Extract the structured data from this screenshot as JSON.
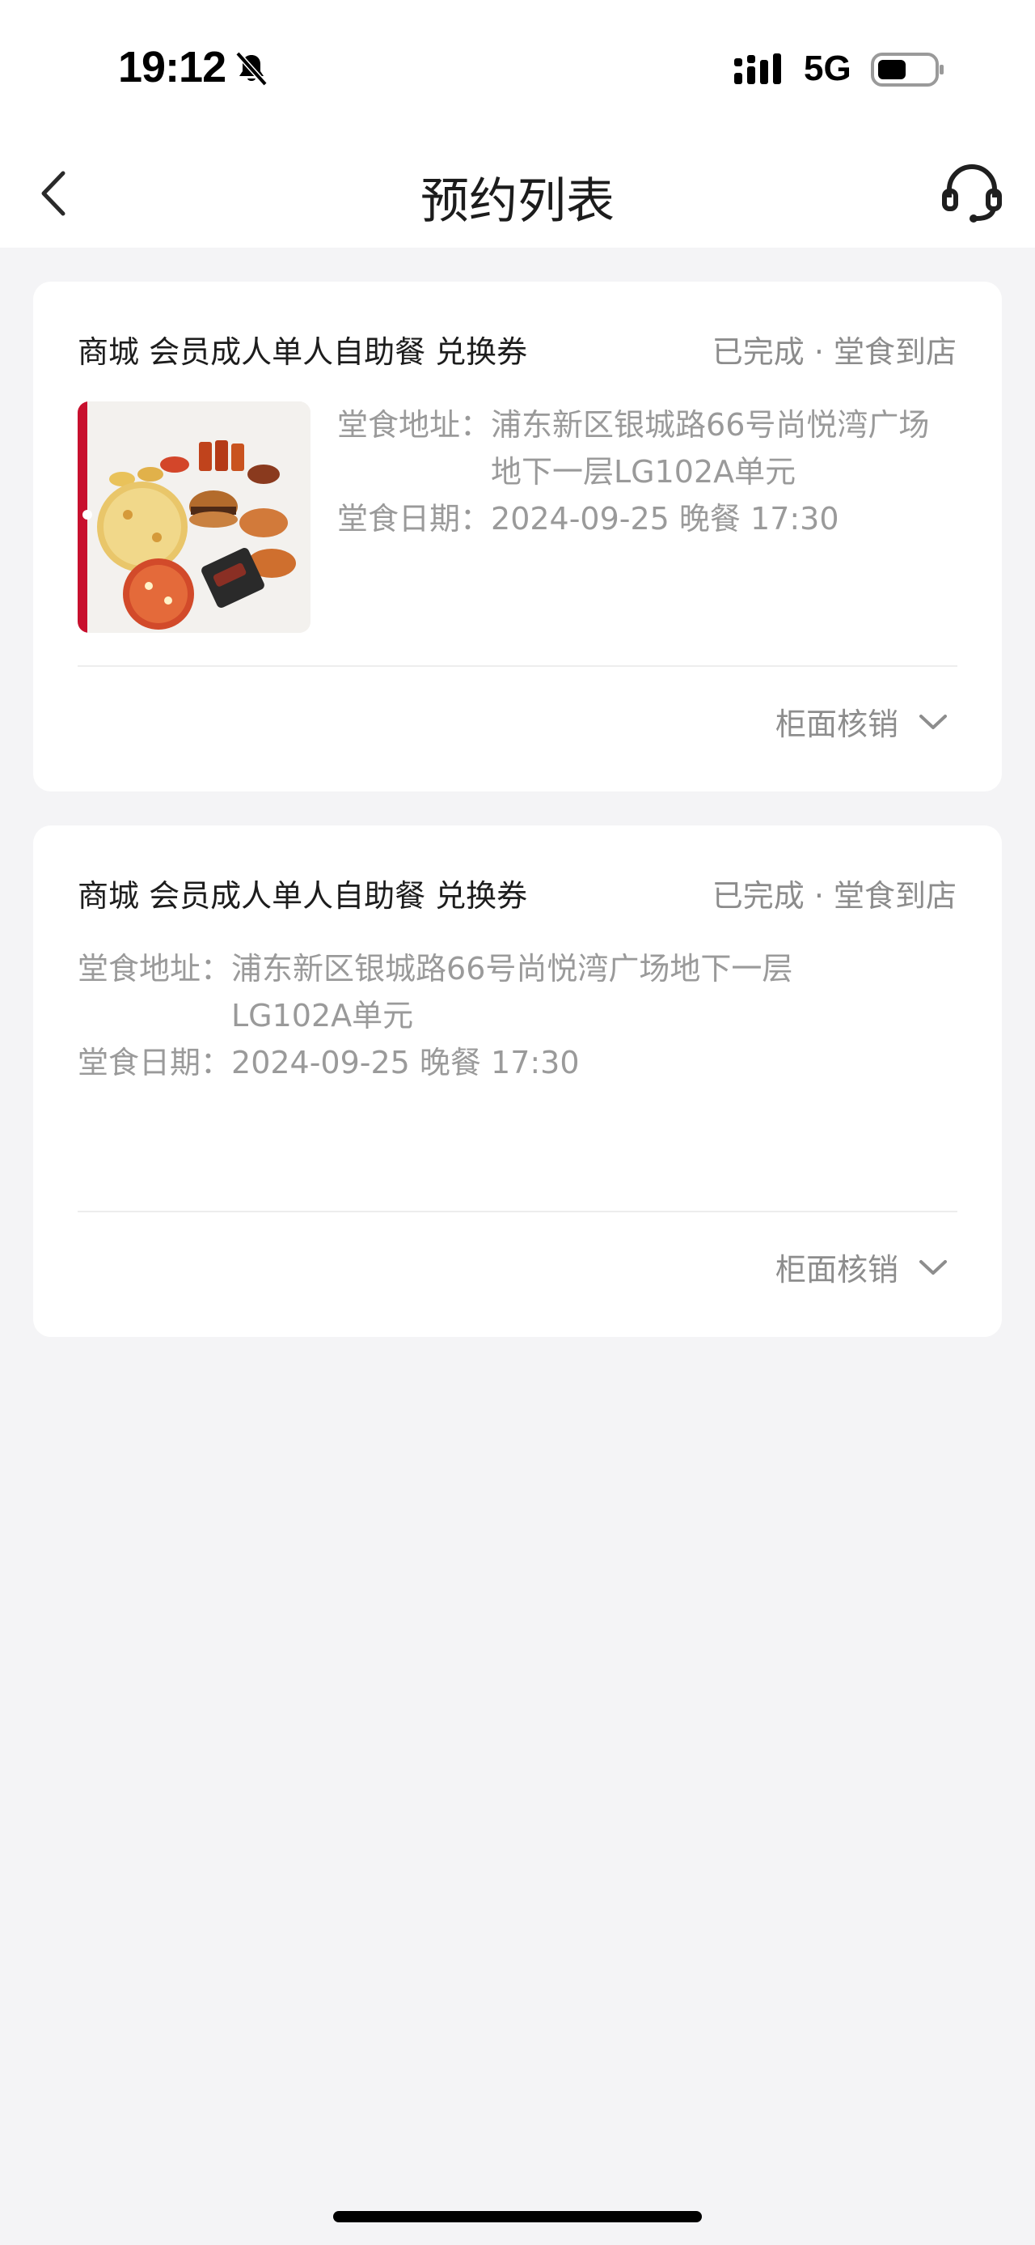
{
  "status_bar": {
    "time": "19:12",
    "network": "5G",
    "icons": [
      "bell-slash-icon",
      "signal-icon",
      "battery-icon"
    ]
  },
  "header": {
    "title": "预约列表",
    "back_icon": "chevron-left-icon",
    "service_icon": "headset-icon"
  },
  "orders": [
    {
      "title": "商城 会员成人单人自助餐 兑换券",
      "status": "已完成 · 堂食到店",
      "address_label": "堂食地址：",
      "address": "浦东新区银城路66号尚悦湾广场地下一层LG102A单元",
      "date_label": "堂食日期：",
      "date": "2024-09-25 晚餐 17:30",
      "action": "柜面核销"
    },
    {
      "title": "商城 会员成人单人自助餐 兑换券",
      "status": "已完成 · 堂食到店",
      "address_label": "堂食地址：",
      "address": "浦东新区银城路66号尚悦湾广场地下一层LG102A单元",
      "date_label": "堂食日期：",
      "date": "2024-09-25 晚餐 17:30",
      "action": "柜面核销"
    }
  ],
  "colors": {
    "page_bg": "#f4f4f6",
    "card_bg": "#ffffff",
    "muted_text": "#9a9a9a",
    "accent_red": "#c8102e"
  }
}
